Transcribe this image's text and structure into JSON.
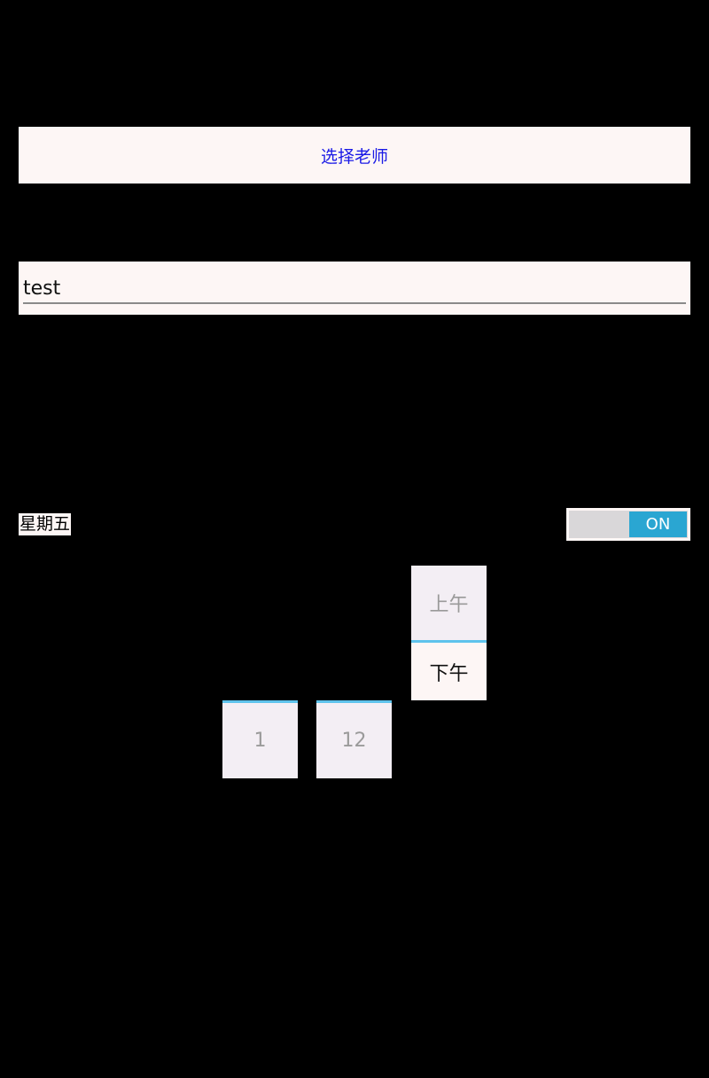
{
  "select_teacher": {
    "label": "选择老师"
  },
  "name_field": {
    "value": "test"
  },
  "weekday": {
    "label": "星期五"
  },
  "toggle": {
    "label": "ON",
    "checked": true
  },
  "time_picker": {
    "hour_next": "1",
    "minute_next": "12",
    "ampm_above": "上午",
    "ampm_selected": "下午"
  },
  "colors": {
    "accent": "#2aa6d2",
    "divider": "#5ec3ec",
    "button_text": "#1a1ae6"
  }
}
